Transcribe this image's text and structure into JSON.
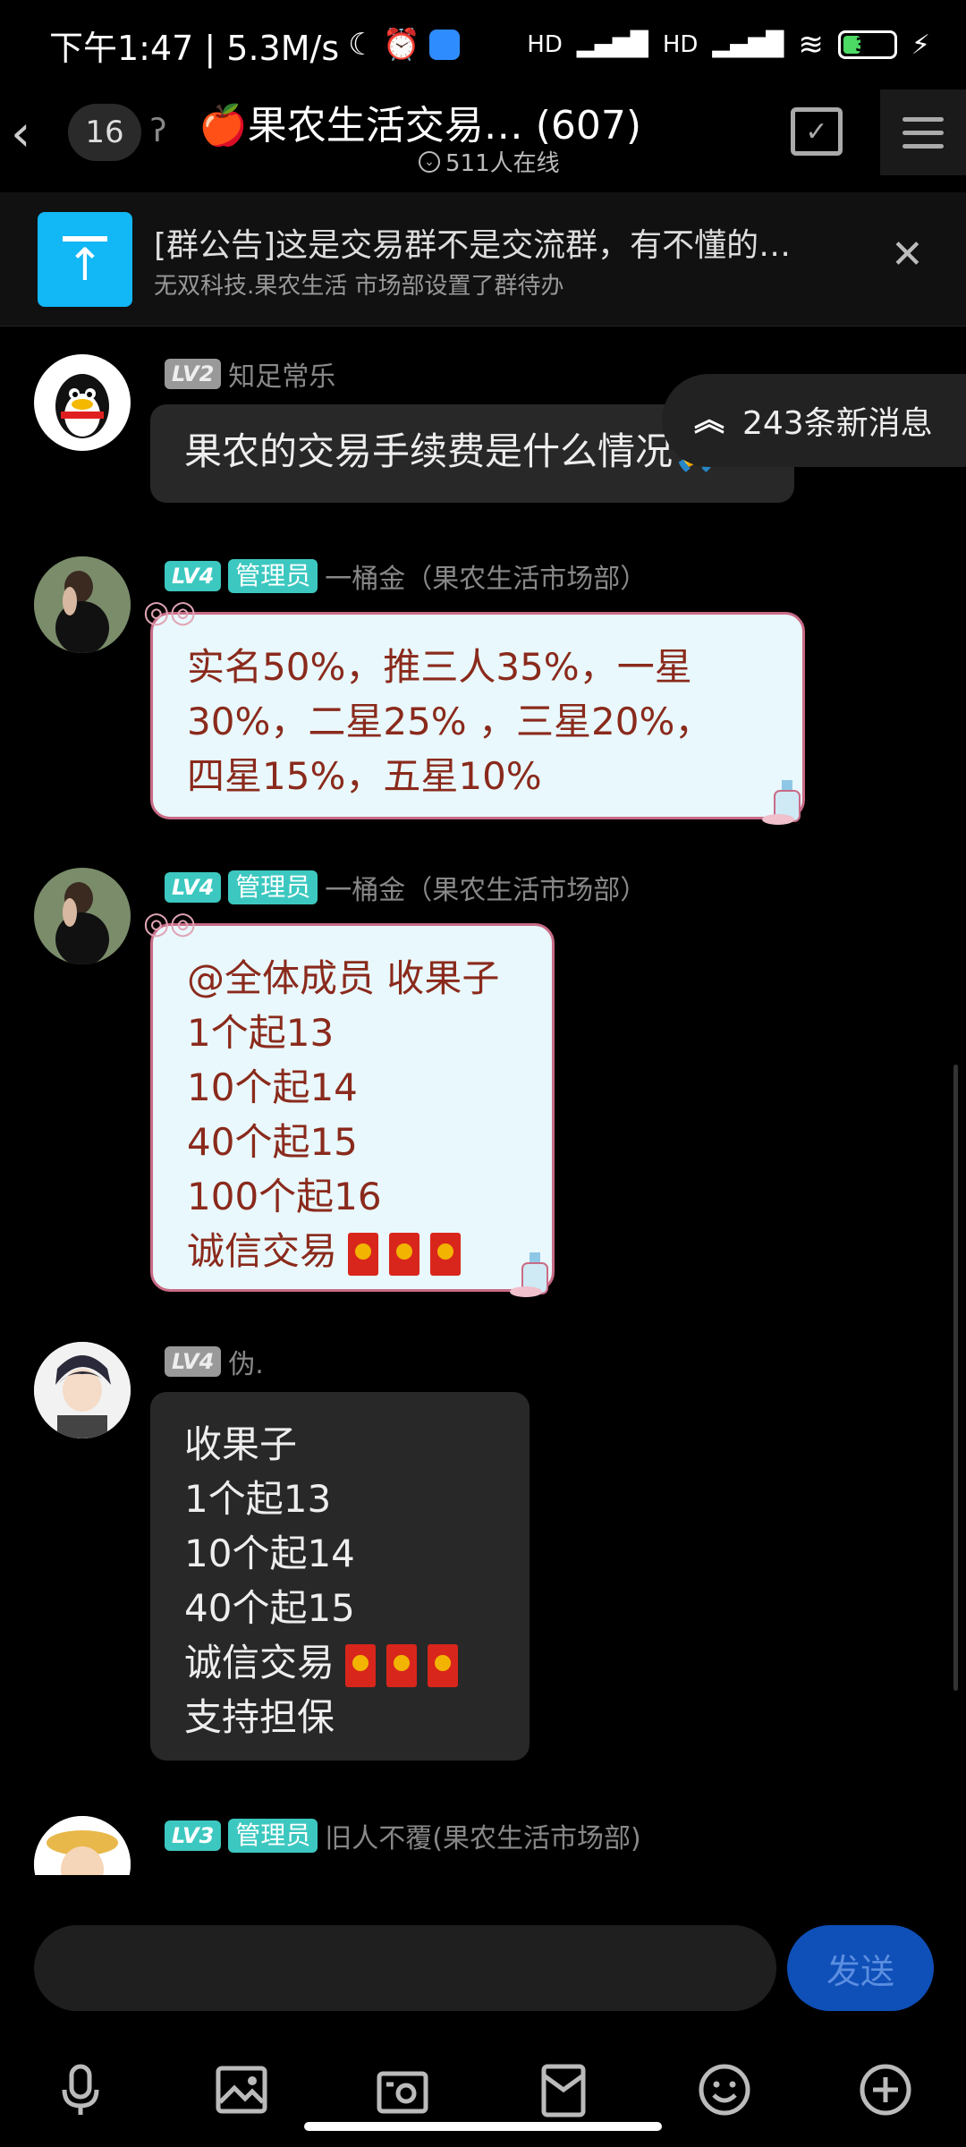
{
  "status": {
    "time_speed": "下午1:47 | 5.3M/s",
    "network": "HD",
    "battery_level": "35",
    "battery_fraction": 0.35
  },
  "header": {
    "unread_count": "16",
    "group_name": "🍎果农生活交易…  (607)",
    "online_text": "511人在线"
  },
  "announcement": {
    "title": "[群公告]这是交易群不是交流群，有不懂的…",
    "subtitle": "无双科技.果农生活 市场部设置了群待办"
  },
  "new_messages": "243条新消息",
  "messages": [
    {
      "level": "LV2",
      "sender": "知足常乐",
      "admin": "",
      "text": "果农的交易手续费是什么情况🙏"
    },
    {
      "level": "LV4",
      "admin": "管理员",
      "sender": "一桶金（果农生活市场部）",
      "text": "实名50%，推三人35%，一星\n30%，二星25% ，三星20%，\n四星15%，五星10%"
    },
    {
      "level": "LV4",
      "admin": "管理员",
      "sender": "一桶金（果农生活市场部）",
      "lines": [
        "@全体成员 收果子",
        "1个起13",
        "10个起14",
        "40个起15",
        "100个起16",
        "诚信交易"
      ]
    },
    {
      "level": "LV4",
      "admin": "",
      "sender": "伪.",
      "lines": [
        "收果子",
        "1个起13",
        "10个起14",
        "40个起15",
        "诚信交易",
        "支持担保"
      ]
    },
    {
      "level": "LV3",
      "admin": "管理员",
      "sender": "旧人不覆(果农生活市场部)"
    }
  ],
  "input": {
    "placeholder": "",
    "send_label": "发送"
  },
  "colors": {
    "accent": "#12b7f5",
    "admin_badge": "#3cc8c0",
    "send_button": "#0f4fb8"
  }
}
